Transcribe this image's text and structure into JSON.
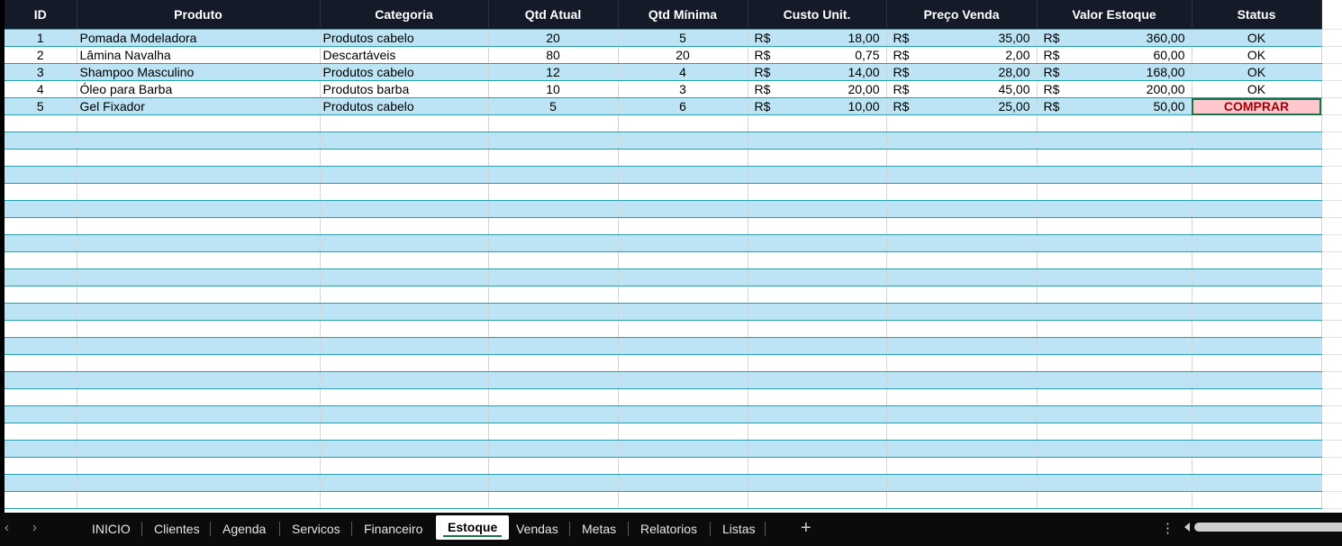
{
  "headers": [
    "ID",
    "Produto",
    "Categoria",
    "Qtd Atual",
    "Qtd Mínima",
    "Custo Unit.",
    "Preço Venda",
    "Valor Estoque",
    "Status"
  ],
  "currency": "R$",
  "rows": [
    {
      "id": "1",
      "produto": "Pomada Modeladora",
      "categoria": "Produtos cabelo",
      "qtd": "20",
      "min": "5",
      "custo": "18,00",
      "preco": "35,00",
      "valor": "360,00",
      "status": "OK"
    },
    {
      "id": "2",
      "produto": "Lâmina Navalha",
      "categoria": "Descartáveis",
      "qtd": "80",
      "min": "20",
      "custo": "0,75",
      "preco": "2,00",
      "valor": "60,00",
      "status": "OK"
    },
    {
      "id": "3",
      "produto": "Shampoo Masculino",
      "categoria": "Produtos cabelo",
      "qtd": "12",
      "min": "4",
      "custo": "14,00",
      "preco": "28,00",
      "valor": "168,00",
      "status": "OK"
    },
    {
      "id": "4",
      "produto": "Óleo para Barba",
      "categoria": "Produtos barba",
      "qtd": "10",
      "min": "3",
      "custo": "20,00",
      "preco": "45,00",
      "valor": "200,00",
      "status": "OK"
    },
    {
      "id": "5",
      "produto": "Gel Fixador",
      "categoria": "Produtos cabelo",
      "qtd": "5",
      "min": "6",
      "custo": "10,00",
      "preco": "25,00",
      "valor": "50,00",
      "status": "COMPRAR"
    }
  ],
  "empty_row_count": 23,
  "colors": {
    "header_bg": "#141a27",
    "band": "#bde4f4",
    "buy_bg": "#ffc7ce",
    "buy_text": "#9c0006",
    "accent": "#1e7145"
  },
  "tabs": {
    "items": [
      "INICIO",
      "Clientes",
      "Agenda",
      "Servicos",
      "Financeiro",
      "Estoque",
      "Vendas",
      "Metas",
      "Relatorios",
      "Listas"
    ],
    "active": "Estoque",
    "add_icon": "plus-icon",
    "more_icon": "vertical-ellipsis-icon",
    "nav_icons": [
      "chevron-left-icon",
      "chevron-right-icon"
    ]
  }
}
